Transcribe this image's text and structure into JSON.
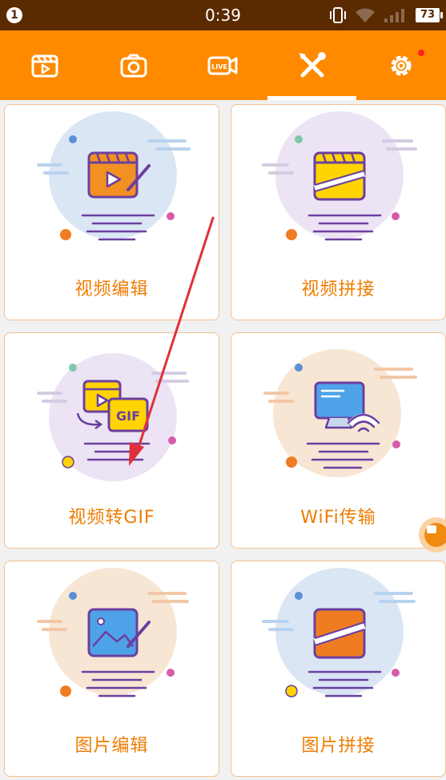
{
  "status_bar": {
    "notification_count": "1",
    "time": "0:39",
    "battery": "73",
    "icons": [
      "vibrate-icon",
      "wifi-icon",
      "signal-icon",
      "battery-icon"
    ]
  },
  "top_nav": {
    "tabs": [
      {
        "name": "video-tab",
        "icon": "film-icon"
      },
      {
        "name": "camera-tab",
        "icon": "camera-icon"
      },
      {
        "name": "live-tab",
        "icon": "live-camera-icon"
      },
      {
        "name": "tools-tab",
        "icon": "tools-icon",
        "selected": true
      },
      {
        "name": "settings-tab",
        "icon": "gear-icon",
        "badge": true
      }
    ]
  },
  "tools": [
    {
      "label": "视频编辑",
      "icon": "video-edit-icon"
    },
    {
      "label": "视频拼接",
      "icon": "video-stitch-icon"
    },
    {
      "label": "视频转GIF",
      "icon": "video-to-gif-icon",
      "badge_text": "GIF"
    },
    {
      "label": "WiFi传输",
      "icon": "wifi-transfer-icon"
    },
    {
      "label": "图片编辑",
      "icon": "image-edit-icon"
    },
    {
      "label": "图片拼接",
      "icon": "image-stitch-icon"
    }
  ],
  "colors": {
    "accent": "#ff8a00",
    "status_bar": "#5a2a00",
    "label": "#f07c00",
    "annotation_arrow": "#e0303a"
  }
}
